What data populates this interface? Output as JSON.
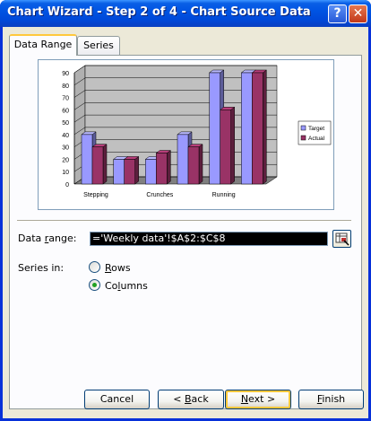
{
  "window": {
    "title": "Chart Wizard - Step 2 of 4 - Chart Source Data",
    "help_label": "?",
    "close_label": "✕"
  },
  "tabs": [
    {
      "label": "Data Range",
      "selected": true
    },
    {
      "label": "Series",
      "selected": false
    }
  ],
  "chart_data": {
    "type": "bar",
    "categories": [
      "Stepping",
      "Crunches",
      "Running",
      ""
    ],
    "category_labels_shown": [
      "Stepping",
      "Crunches",
      "Running"
    ],
    "series": [
      {
        "name": "Target",
        "values": [
          40,
          20,
          40,
          90
        ],
        "color": "#9999ff"
      },
      {
        "name": "Actual",
        "values": [
          30,
          20,
          30,
          90
        ],
        "color": "#993366"
      }
    ],
    "extra_bars": [
      {
        "category_index": 1,
        "series": "Target",
        "value": 20
      },
      {
        "category_index": 1,
        "series": "Actual",
        "value": 25
      }
    ],
    "ylim": [
      0,
      90
    ],
    "yticks": [
      "0",
      "10",
      "20",
      "30",
      "40",
      "50",
      "60",
      "70",
      "80",
      "90"
    ],
    "legend": [
      "Target",
      "Actual"
    ],
    "legend_position": "right",
    "grid": true,
    "style": "3D clustered column"
  },
  "data_range": {
    "label_pre": "Data ",
    "label_acc": "r",
    "label_post": "ange:",
    "value": "='Weekly data'!$A$2:$C$8"
  },
  "series_in": {
    "label": "Series in:",
    "rows_acc": "R",
    "rows_rest": "ows",
    "columns_acc": "l",
    "columns_pre": "Co",
    "columns_post": "umns",
    "selected": "Columns"
  },
  "buttons": {
    "cancel": "Cancel",
    "back_pre": "< ",
    "back_acc": "B",
    "back_post": "ack",
    "next_acc": "N",
    "next_post": "ext >",
    "finish_acc": "F",
    "finish_post": "inish"
  }
}
